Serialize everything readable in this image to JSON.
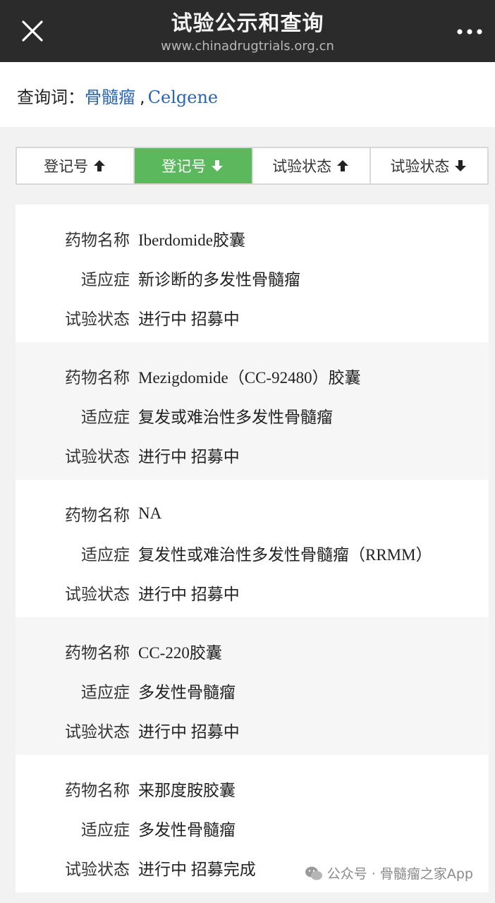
{
  "header": {
    "title": "试验公示和查询",
    "subtitle": "www.chinadrugtrials.org.cn",
    "close_icon": "close-icon",
    "more_icon": "more-horizontal-icon"
  },
  "query": {
    "label": "查询词：",
    "term1": "骨髓瘤",
    "separator": ",",
    "term2": "Celgene",
    "term_color": "#2a64b4"
  },
  "sort": {
    "active_color": "#5bb85c",
    "buttons": [
      {
        "label": "登记号",
        "direction": "up",
        "active": false
      },
      {
        "label": "登记号",
        "direction": "down",
        "active": true
      },
      {
        "label": "试验状态",
        "direction": "up",
        "active": false
      },
      {
        "label": "试验状态",
        "direction": "down",
        "active": false
      }
    ]
  },
  "results": [
    {
      "drug_label": "药物名称",
      "drug": "Iberdomide胶囊",
      "indication_label": "适应症",
      "indication": "新诊断的多发性骨髓瘤",
      "status_label": "试验状态",
      "status": "进行中 招募中"
    },
    {
      "drug_label": "药物名称",
      "drug": "Mezigdomide（CC-92480）胶囊",
      "indication_label": "适应症",
      "indication": "复发或难治性多发性骨髓瘤",
      "status_label": "试验状态",
      "status": "进行中 招募中"
    },
    {
      "drug_label": "药物名称",
      "drug": "NA",
      "indication_label": "适应症",
      "indication": "复发性或难治性多发性骨髓瘤（RRMM）",
      "status_label": "试验状态",
      "status": "进行中 招募中"
    },
    {
      "drug_label": "药物名称",
      "drug": "CC-220胶囊",
      "indication_label": "适应症",
      "indication": "多发性骨髓瘤",
      "status_label": "试验状态",
      "status": "进行中 招募中"
    },
    {
      "drug_label": "药物名称",
      "drug": "来那度胺胶囊",
      "indication_label": "适应症",
      "indication": "多发性骨髓瘤",
      "status_label": "试验状态",
      "status": "进行中 招募完成"
    }
  ],
  "watermark": {
    "text": "公众号 · 骨髓瘤之家App",
    "icon": "wechat-icon"
  }
}
